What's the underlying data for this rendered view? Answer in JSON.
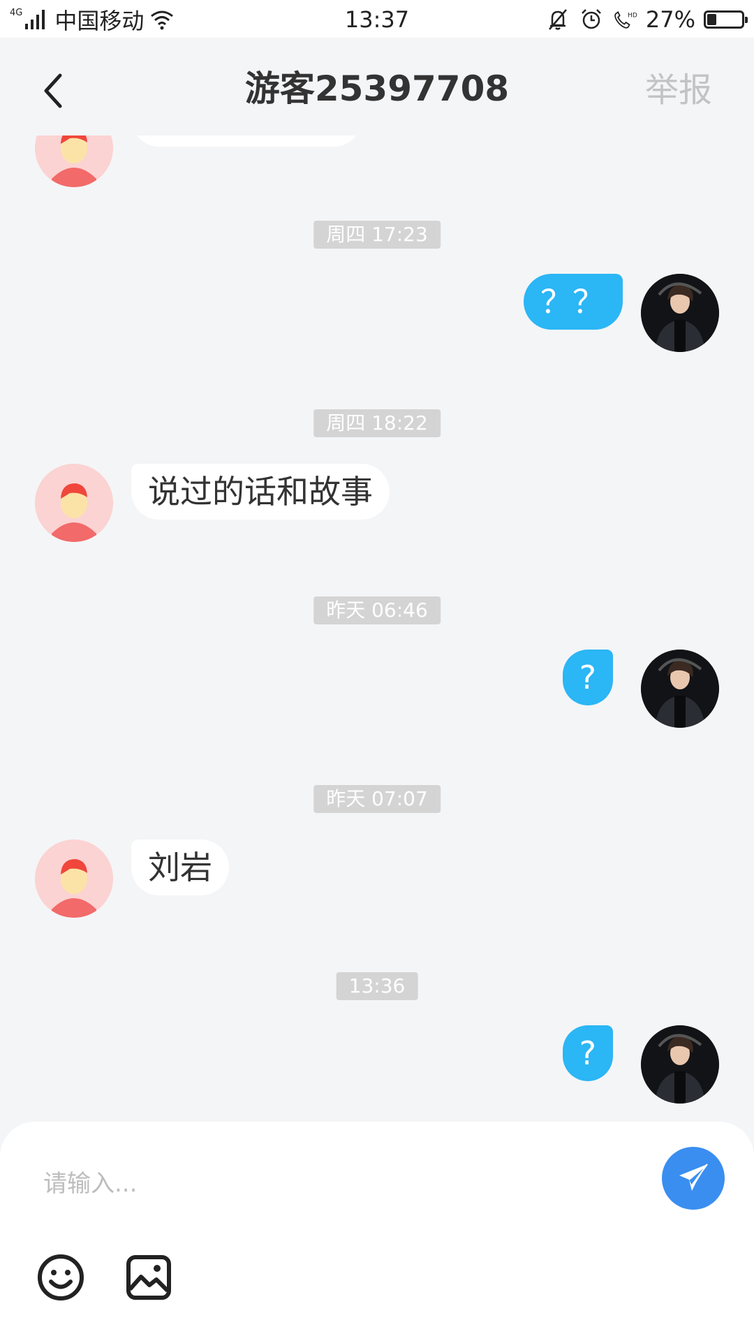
{
  "status_bar": {
    "network_type": "4G",
    "carrier": "中国移动",
    "time": "13:37",
    "battery_percent_text": "27%",
    "battery_level": 0.27,
    "hd_label": "HD",
    "icons": [
      "signal-icon",
      "wifi-icon",
      "mute-bell-icon",
      "alarm-icon",
      "hd-call-icon",
      "battery-icon"
    ]
  },
  "header": {
    "title": "游客25397708",
    "report_label": "举报",
    "back_icon": "chevron-left-icon"
  },
  "messages": [
    {
      "type": "time",
      "text": "周四 17:23"
    },
    {
      "type": "msg",
      "from": "self",
      "text": "？？"
    },
    {
      "type": "time",
      "text": "周四 18:22"
    },
    {
      "type": "msg",
      "from": "other",
      "text": "说过的话和故事"
    },
    {
      "type": "time",
      "text": "昨天 06:46"
    },
    {
      "type": "msg",
      "from": "self",
      "text": "?"
    },
    {
      "type": "time",
      "text": "昨天 07:07"
    },
    {
      "type": "msg",
      "from": "other",
      "text": "刘岩"
    },
    {
      "type": "time",
      "text": "13:36"
    },
    {
      "type": "msg",
      "from": "self",
      "text": "?"
    }
  ],
  "input": {
    "value": "",
    "placeholder": "请输入..."
  },
  "toolbar": {
    "send_icon": "paper-plane-icon",
    "emoji_icon": "emoji-icon",
    "image_icon": "image-icon"
  },
  "colors": {
    "self_bubble": "#2bb6f5",
    "other_bubble": "#ffffff",
    "send_button": "#3a8ef0",
    "background": "#f4f5f7",
    "report_text": "#c3c3c3"
  }
}
